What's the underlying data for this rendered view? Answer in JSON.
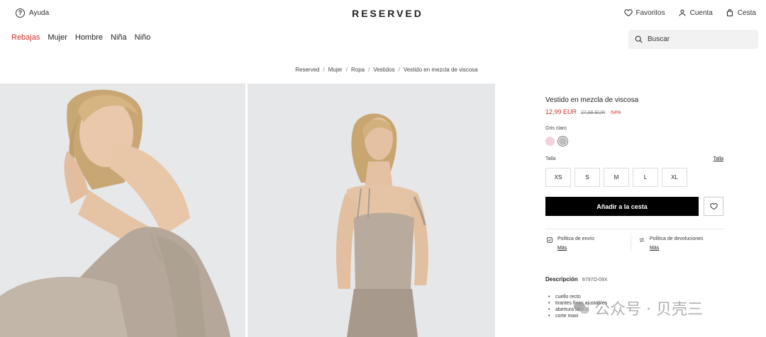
{
  "header": {
    "help_label": "Ayuda",
    "logo": "RESERVED",
    "favorites_label": "Favoritos",
    "account_label": "Cuenta",
    "cart_label": "Cesta"
  },
  "nav": {
    "items": [
      "Rebajas",
      "Mujer",
      "Hombre",
      "Niña",
      "Niño"
    ],
    "sale_color": "#d0312d"
  },
  "search": {
    "placeholder": "Buscar"
  },
  "breadcrumb": [
    "Reserved",
    "Mujer",
    "Ropa",
    "Vestidos",
    "Vestido en mezcla de viscosa"
  ],
  "product": {
    "title": "Vestido en mezcla de viscosa",
    "price": "12,99 EUR",
    "old_price": "27,99 EUR",
    "discount": "-54%",
    "color_label": "Gris claro",
    "swatch_colors": [
      "#f3d2dc",
      "#bdbdbd"
    ],
    "size_label": "Talla",
    "size_guide": "Talla",
    "sizes": [
      "XS",
      "S",
      "M",
      "L",
      "XL"
    ],
    "add_to_cart": "Añadir a la cesta",
    "shipping_policy": "Política de envío",
    "return_policy": "Política de devoluciones",
    "more": "Más",
    "description_label": "Descripción",
    "code": "9797O-09X",
    "description_items": [
      "cuello recto",
      "tirantes finos ajustables",
      "abertura lateral",
      "corte maxi"
    ]
  },
  "watermark": {
    "text": "公众号 · 贝壳三"
  }
}
